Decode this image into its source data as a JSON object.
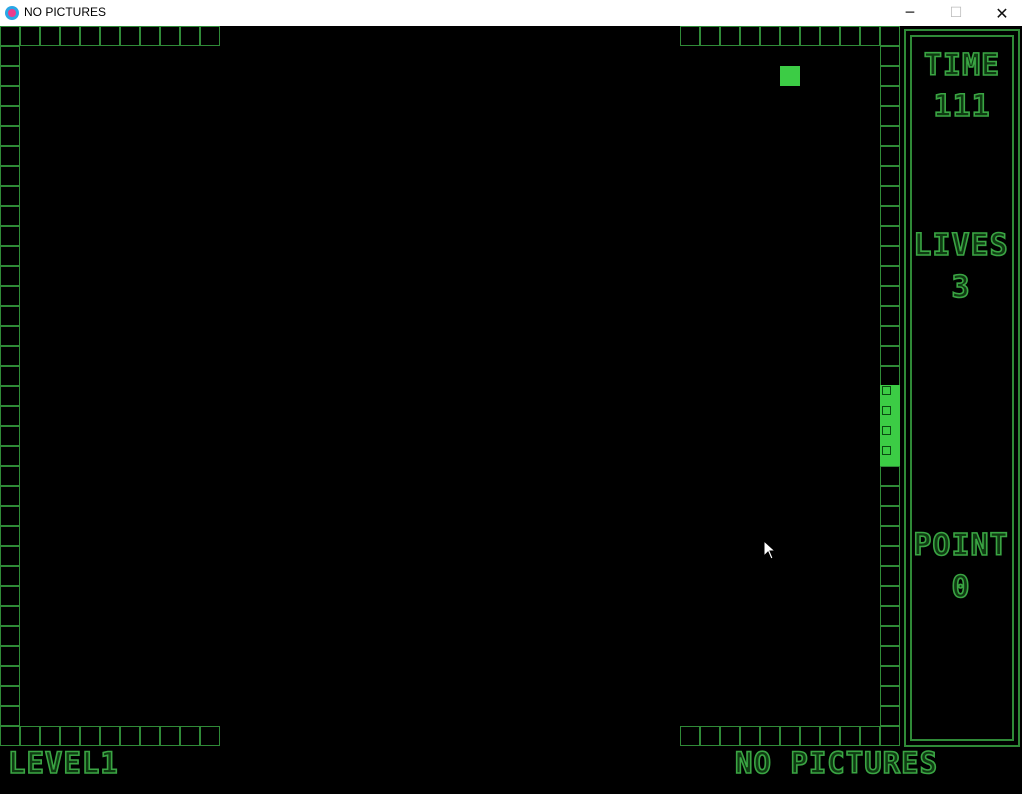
{
  "window": {
    "title": "NO PICTURES",
    "icon": "app-heart-icon",
    "controls": {
      "minimize": "─",
      "maximize": "☐",
      "close": "✕"
    }
  },
  "hud": {
    "time_label": "TIME",
    "time_value": "111",
    "lives_label": "LIVES",
    "lives_value": "3",
    "point_label": "POINT",
    "point_value": "0"
  },
  "footer": {
    "level": "LEVEL1",
    "game_name": "NO PICTURES"
  },
  "colors": {
    "background": "#000000",
    "wall": "#2f8a37",
    "snake": "#3ccc45",
    "food": "#3ccc45",
    "text": "#3aa543"
  },
  "game": {
    "snake_length": 4,
    "snake_direction": "vertical"
  }
}
